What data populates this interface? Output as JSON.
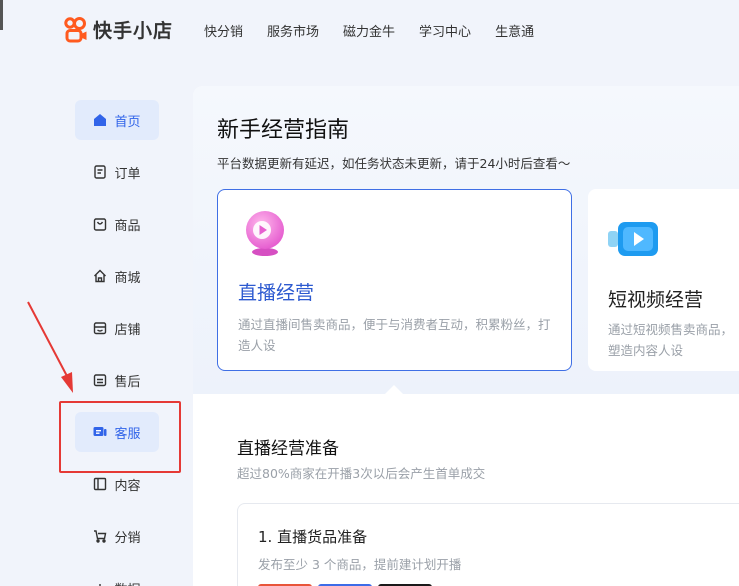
{
  "header": {
    "logo_text": "快手小店",
    "nav": [
      "快分销",
      "服务市场",
      "磁力金牛",
      "学习中心",
      "生意通"
    ]
  },
  "sidebar": {
    "items": [
      {
        "label": "首页",
        "icon": "home-icon"
      },
      {
        "label": "订单",
        "icon": "order-icon"
      },
      {
        "label": "商品",
        "icon": "product-icon"
      },
      {
        "label": "商城",
        "icon": "mall-icon"
      },
      {
        "label": "店铺",
        "icon": "store-icon"
      },
      {
        "label": "售后",
        "icon": "after-sales-icon"
      },
      {
        "label": "客服",
        "icon": "customer-service-icon"
      },
      {
        "label": "内容",
        "icon": "content-icon"
      },
      {
        "label": "分销",
        "icon": "distribution-icon"
      },
      {
        "label": "数据",
        "icon": "data-icon"
      }
    ]
  },
  "guide": {
    "title": "新手经营指南",
    "subtitle": "平台数据更新有延迟，如任务状态未更新，请于24小时后查看～",
    "cards": [
      {
        "title": "直播经营",
        "desc": "通过直播间售卖商品，便于与消费者互动，积累粉丝，打造人设"
      },
      {
        "title": "短视频经营",
        "desc_line1": "通过短视频售卖商品，",
        "desc_line2": "塑造内容人设"
      }
    ]
  },
  "prep": {
    "title": "直播经营准备",
    "subtitle": "超过80%商家在开播3次以后会产生首单成交",
    "step": {
      "title": "1. 直播货品准备",
      "desc": "发布至少 3 个商品，提前建计划开播"
    }
  },
  "colors": {
    "accent": "#3164e9",
    "logo_orange": "#ff5a1f",
    "annotation_red": "#e53935"
  }
}
